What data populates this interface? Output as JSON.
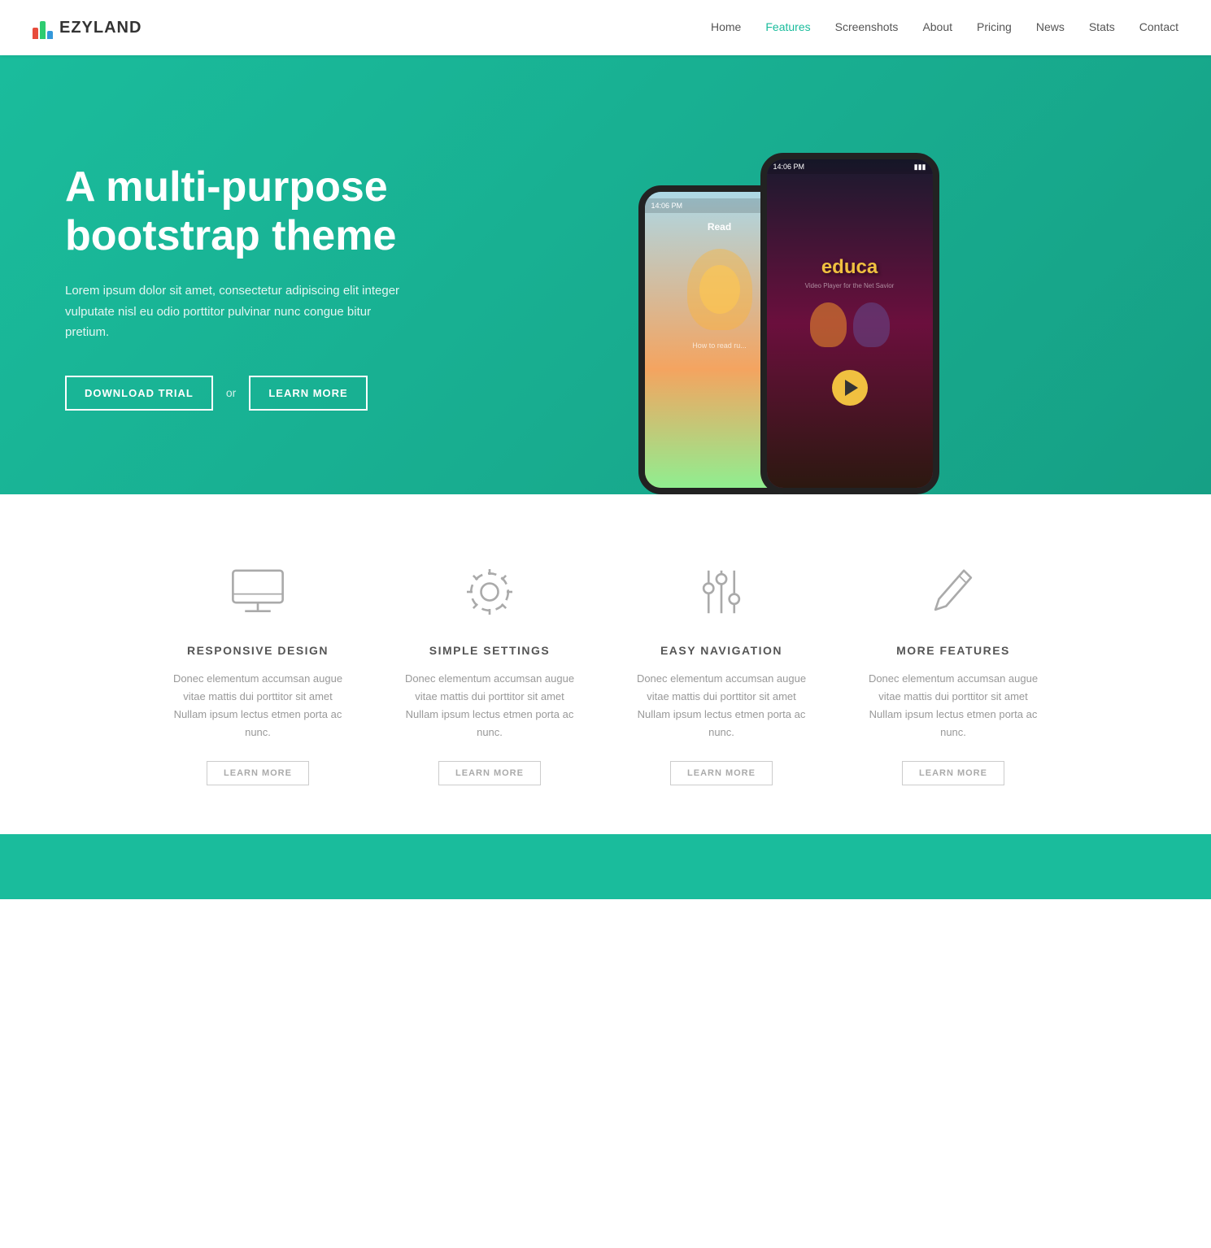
{
  "nav": {
    "brand": "EZYLAND",
    "links": [
      {
        "label": "Home",
        "active": false
      },
      {
        "label": "Features",
        "active": true
      },
      {
        "label": "Screenshots",
        "active": false
      },
      {
        "label": "About",
        "active": false
      },
      {
        "label": "Pricing",
        "active": false
      },
      {
        "label": "News",
        "active": false
      },
      {
        "label": "Stats",
        "active": false
      },
      {
        "label": "Contact",
        "active": false
      }
    ]
  },
  "hero": {
    "title": "A multi-purpose bootstrap theme",
    "description": "Lorem ipsum dolor sit amet, consectetur adipiscing elit integer vulputate nisl eu odio porttitor pulvinar nunc congue bitur pretium.",
    "btn_download": "DOWNLOAD TRIAL",
    "btn_or": "or",
    "btn_learn": "LEARN MORE",
    "phone_left_time": "14:06 PM",
    "phone_right_time": "14:06 PM",
    "phone_left_app": "How to read ru...",
    "phone_right_brand": "educa",
    "phone_right_subtitle": "Video Player for the Net Savior"
  },
  "features": [
    {
      "icon": "monitor",
      "title": "RESPONSIVE DESIGN",
      "description": "Donec elementum accumsan augue vitae mattis dui porttitor sit amet Nullam ipsum lectus etmen porta ac nunc.",
      "btn": "LEARN MORE"
    },
    {
      "icon": "settings",
      "title": "SIMPLE SETTINGS",
      "description": "Donec elementum accumsan augue vitae mattis dui porttitor sit amet Nullam ipsum lectus etmen porta ac nunc.",
      "btn": "LEARN MORE"
    },
    {
      "icon": "sliders",
      "title": "EASY NAVIGATION",
      "description": "Donec elementum accumsan augue vitae mattis dui porttitor sit amet Nullam ipsum lectus etmen porta ac nunc.",
      "btn": "LEARN MORE"
    },
    {
      "icon": "pencil",
      "title": "MORE FEATURES",
      "description": "Donec elementum accumsan augue vitae mattis dui porttitor sit amet Nullam ipsum lectus etmen porta ac nunc.",
      "btn": "LEARN MORE"
    }
  ]
}
